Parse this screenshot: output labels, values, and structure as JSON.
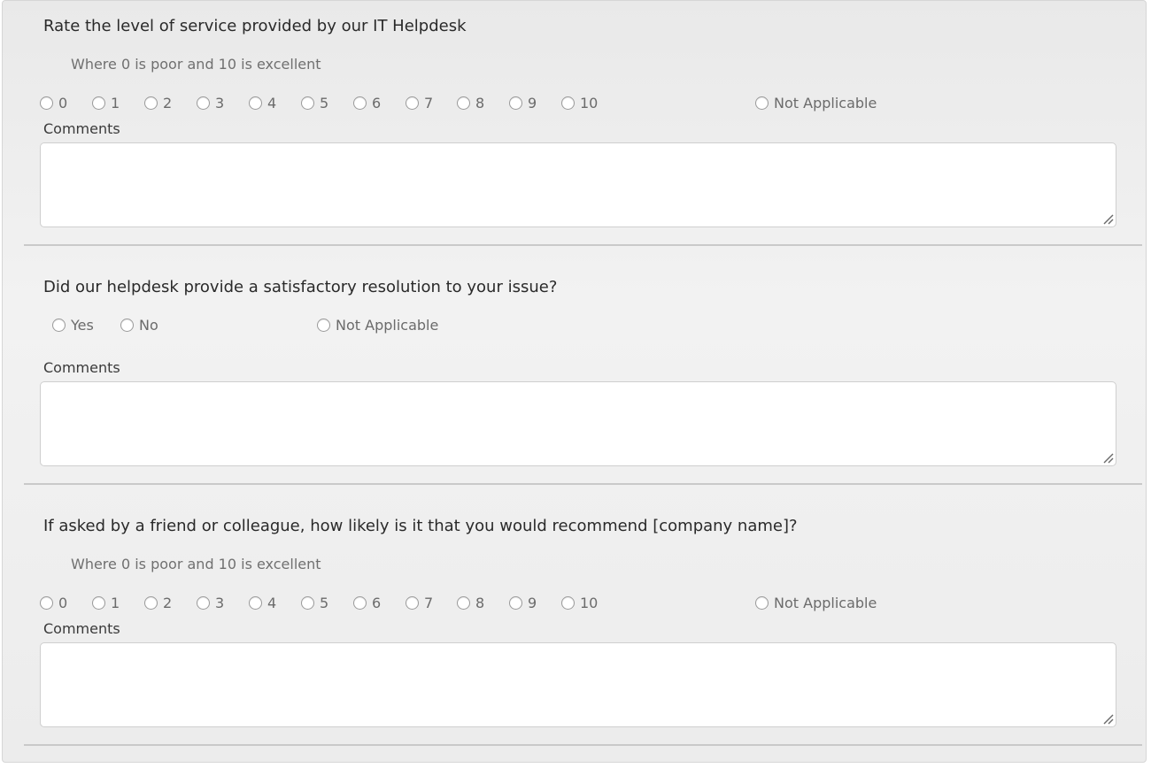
{
  "questions": [
    {
      "title": "Rate the level of service provided by our IT Helpdesk",
      "hint": "Where 0 is poor and 10 is excellent",
      "options": [
        "0",
        "1",
        "2",
        "3",
        "4",
        "5",
        "6",
        "7",
        "8",
        "9",
        "10"
      ],
      "na_label": "Not Applicable",
      "comments_label": "Comments"
    },
    {
      "title": "Did our helpdesk provide a satisfactory resolution to your issue?",
      "options": [
        "Yes",
        "No"
      ],
      "na_label": "Not Applicable",
      "comments_label": "Comments"
    },
    {
      "title": "If asked by a friend or colleague, how likely is it that you would recommend [company name]?",
      "hint": "Where 0 is poor and 10 is excellent",
      "options": [
        "0",
        "1",
        "2",
        "3",
        "4",
        "5",
        "6",
        "7",
        "8",
        "9",
        "10"
      ],
      "na_label": "Not Applicable",
      "comments_label": "Comments"
    }
  ]
}
